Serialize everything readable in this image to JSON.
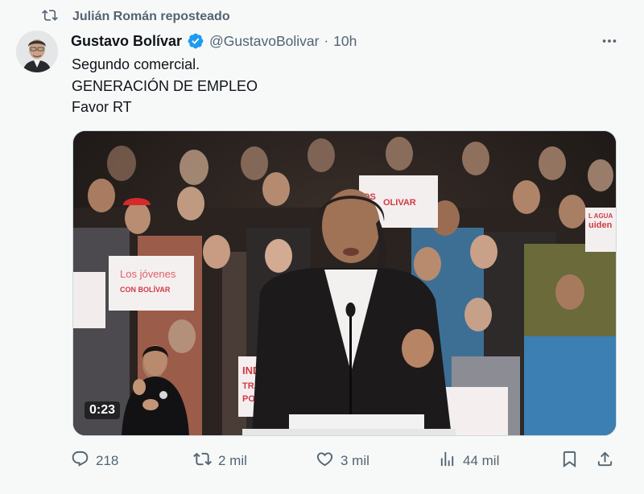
{
  "repost": {
    "text": "Julián Román reposteado",
    "icon": "repost-icon"
  },
  "author": {
    "display_name": "Gustavo Bolívar",
    "handle": "@GustavoBolivar",
    "separator": "·",
    "time": "10h",
    "verified_color": "#1d9bf0"
  },
  "tweet": {
    "lines": [
      "Segundo comercial.",
      "GENERACIÓN DE EMPLEO",
      "Favor RT"
    ]
  },
  "media": {
    "duration": "0:23",
    "signs": [
      "Los jóvenes",
      "CON BOLÍVAR",
      "OS",
      "OLIVAR",
      "uiden",
      "L AGUA",
      "IND",
      "TRA",
      "PO"
    ]
  },
  "actions": {
    "replies": "218",
    "reposts": "2 mil",
    "likes": "3 mil",
    "views": "44 mil"
  },
  "colors": {
    "secondary_text": "#536471",
    "primary_text": "#0f1419",
    "background": "#f7f9f9"
  }
}
